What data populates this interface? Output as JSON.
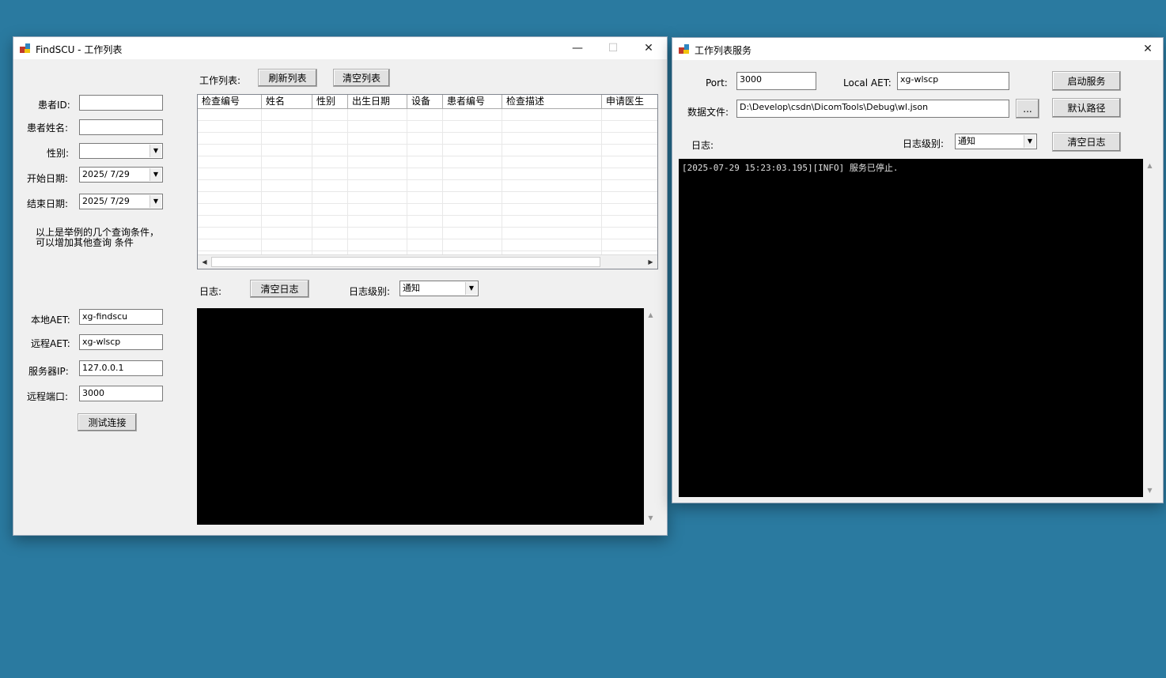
{
  "findscu": {
    "title": "FindSCU - 工作列表",
    "window_controls": {
      "minimize": "—",
      "maximize": "☐",
      "close": "✕"
    },
    "query": {
      "patient_id_label": "患者ID:",
      "patient_id_value": "",
      "patient_name_label": "患者姓名:",
      "patient_name_value": "",
      "sex_label": "性别:",
      "sex_value": "",
      "start_date_label": "开始日期:",
      "start_date_value": "2025/  7/29",
      "end_date_label": "结束日期:",
      "end_date_value": "2025/  7/29",
      "note_line1": "以上是举例的几个查询条件，",
      "note_line2": "可以增加其他查询 条件"
    },
    "connection": {
      "local_aet_label": "本地AET:",
      "local_aet_value": "xg-findscu",
      "remote_aet_label": "远程AET:",
      "remote_aet_value": "xg-wlscp",
      "server_ip_label": "服务器IP:",
      "server_ip_value": "127.0.0.1",
      "remote_port_label": "远程端口:",
      "remote_port_value": "3000",
      "test_button": "测试连接"
    },
    "worklist": {
      "label": "工作列表:",
      "refresh_button": "刷新列表",
      "clear_button": "清空列表",
      "columns": [
        "检查编号",
        "姓名",
        "性别",
        "出生日期",
        "设备",
        "患者编号",
        "检查描述",
        "申请医生"
      ]
    },
    "log": {
      "label": "日志:",
      "clear_button": "清空日志",
      "level_label": "日志级别:",
      "level_value": "通知"
    }
  },
  "wlscp": {
    "title": "工作列表服务",
    "close": "✕",
    "port_label": "Port:",
    "port_value": "3000",
    "local_aet_label": "Local AET:",
    "local_aet_value": "xg-wlscp",
    "start_button": "启动服务",
    "data_file_label": "数据文件:",
    "data_file_value": "D:\\Develop\\csdn\\DicomTools\\Debug\\wl.json",
    "browse_button": "...",
    "default_path_button": "默认路径",
    "log_label": "日志:",
    "level_label": "日志级别:",
    "level_value": "通知",
    "clear_log_button": "清空日志",
    "log_lines": [
      "[2025-07-29 15:23:03.195][INFO] 服务已停止."
    ]
  }
}
